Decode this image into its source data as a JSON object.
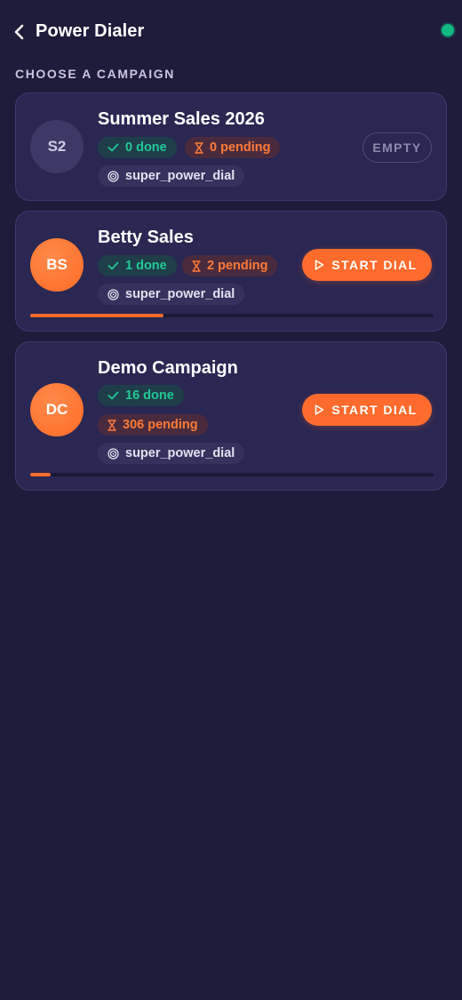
{
  "header": {
    "title": "Power Dialer",
    "status": "online",
    "status_color": "#12b981"
  },
  "section_label": "CHOOSE A CAMPAIGN",
  "colors": {
    "background": "#1e1b3b",
    "card": "#2a2752",
    "accent": "#ff6b2c",
    "done": "#22c995",
    "pending": "#ff7a36"
  },
  "campaigns": [
    {
      "initials": "S2",
      "name": "Summer Sales 2026",
      "done": "0 done",
      "pending": "0 pending",
      "tag": "super_power_dial",
      "action": "EMPTY",
      "progress": null
    },
    {
      "initials": "BS",
      "name": "Betty Sales",
      "done": "1 done",
      "pending": "2 pending",
      "tag": "super_power_dial",
      "action": "START DIAL",
      "progress": 0.33
    },
    {
      "initials": "DC",
      "name": "Demo Campaign",
      "done": "16 done",
      "pending": "306 pending",
      "tag": "super_power_dial",
      "action": "START DIAL",
      "progress": 0.05
    }
  ],
  "icons": {
    "back": "chevron-left-icon",
    "done": "check-icon",
    "pending": "hourglass-icon",
    "tag": "target-icon",
    "start": "play-icon"
  }
}
